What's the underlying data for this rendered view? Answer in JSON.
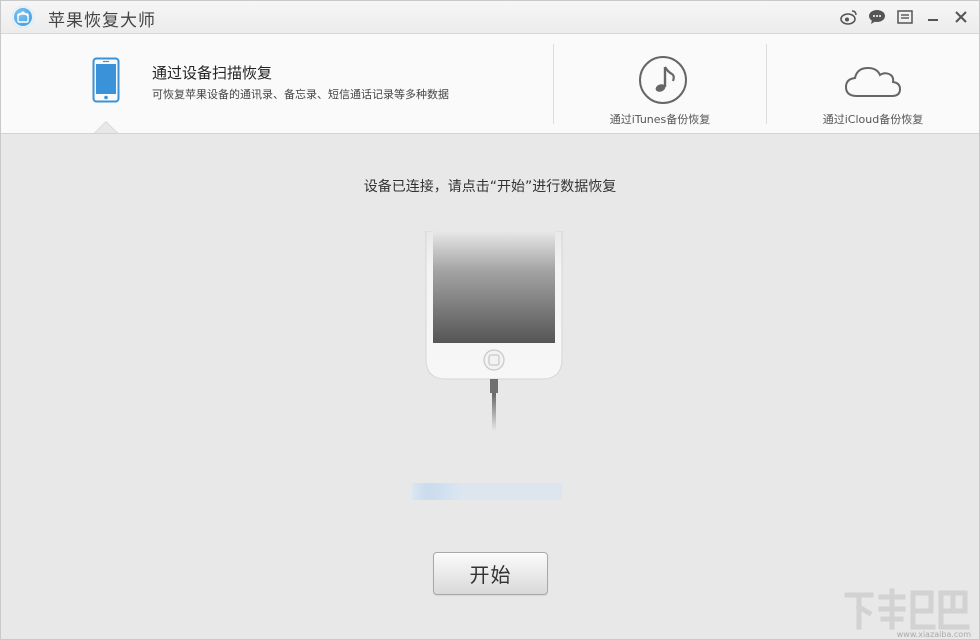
{
  "window": {
    "title": "苹果恢复大师"
  },
  "titlebar": {
    "icons": [
      "weibo-icon",
      "chat-icon",
      "menu-icon",
      "minimize-icon",
      "close-icon"
    ]
  },
  "nav": {
    "scan": {
      "title": "通过设备扫描恢复",
      "description": "可恢复苹果设备的通讯录、备忘录、短信通话记录等多种数据"
    },
    "itunes": {
      "label": "通过iTunes备份恢复"
    },
    "icloud": {
      "label": "通过iCloud备份恢复"
    }
  },
  "main": {
    "status": "设备已连接，请点击“开始”进行数据恢复",
    "progress": 0.33,
    "start_button": "开始"
  },
  "watermark": {
    "text": "www.xiazaiba.com"
  },
  "colors": {
    "accent": "#3a93d9",
    "background": "#e8e8e8",
    "nav_background": "#fafafa"
  }
}
